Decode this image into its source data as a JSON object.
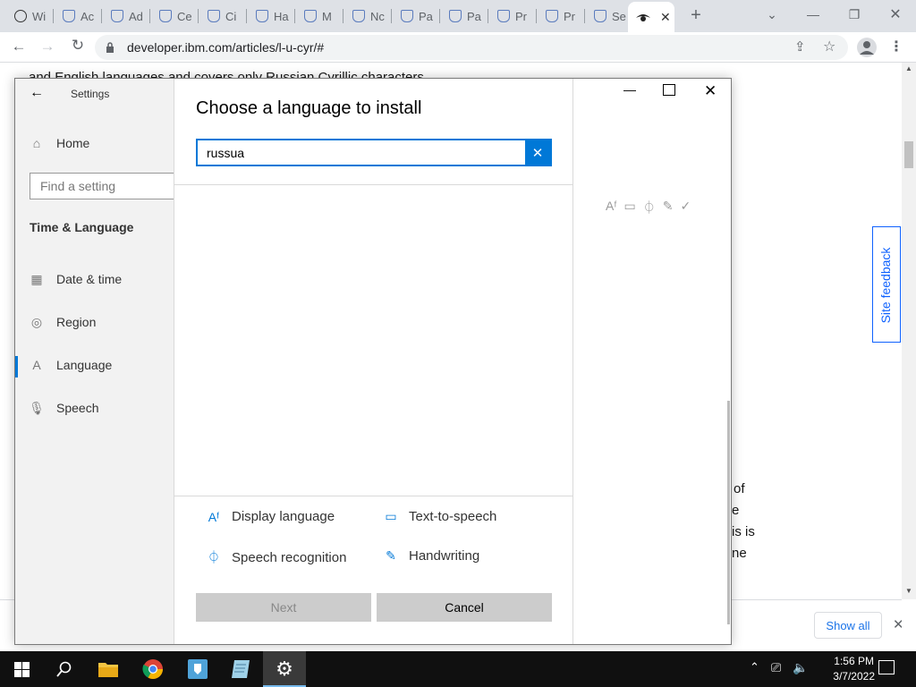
{
  "browser": {
    "tabs": [
      {
        "label": "Wi",
        "icon": "eye-icon"
      },
      {
        "label": "Ac",
        "icon": "shield-icon"
      },
      {
        "label": "Ad",
        "icon": "shield-icon"
      },
      {
        "label": "Ce",
        "icon": "shield-icon"
      },
      {
        "label": "Ci",
        "icon": "shield-icon"
      },
      {
        "label": "Ha",
        "icon": "shield-icon"
      },
      {
        "label": "M",
        "icon": "shield-icon"
      },
      {
        "label": "Nc",
        "icon": "shield-icon"
      },
      {
        "label": "Pa",
        "icon": "shield-icon"
      },
      {
        "label": "Pa",
        "icon": "shield-icon"
      },
      {
        "label": "Pr",
        "icon": "shield-icon"
      },
      {
        "label": "Pr",
        "icon": "shield-icon"
      },
      {
        "label": "Se",
        "icon": "shield-icon"
      }
    ],
    "url": "developer.ibm.com/articles/l-u-cyr/#"
  },
  "webpage": {
    "top_text": "and English languages and covers only Russian Cyrillic characters.",
    "fragments": [
      "of",
      "e",
      "is is",
      "ne"
    ],
    "site_feedback": "Site feedback",
    "show_all": "Show all"
  },
  "settings": {
    "title": "Settings",
    "home": "Home",
    "search_placeholder": "Find a setting",
    "section": "Time & Language",
    "nav": [
      {
        "label": "Date & time",
        "icon": "calendar-clock-icon"
      },
      {
        "label": "Region",
        "icon": "globe-icon"
      },
      {
        "label": "Language",
        "icon": "language-icon"
      },
      {
        "label": "Speech",
        "icon": "microphone-icon"
      }
    ]
  },
  "dialog": {
    "title": "Choose a language to install",
    "search_value": "russua",
    "features": [
      {
        "label": "Display language",
        "icon": "display-language-icon"
      },
      {
        "label": "Text-to-speech",
        "icon": "text-to-speech-icon"
      },
      {
        "label": "Speech recognition",
        "icon": "microphone-icon"
      },
      {
        "label": "Handwriting",
        "icon": "handwriting-icon"
      }
    ],
    "next_label": "Next",
    "cancel_label": "Cancel"
  },
  "taskbar": {
    "time": "1:56 PM",
    "date": "3/7/2022"
  },
  "colors": {
    "accent": "#0078d7",
    "taskbar": "#101010",
    "sidebar": "#f2f2f2"
  }
}
